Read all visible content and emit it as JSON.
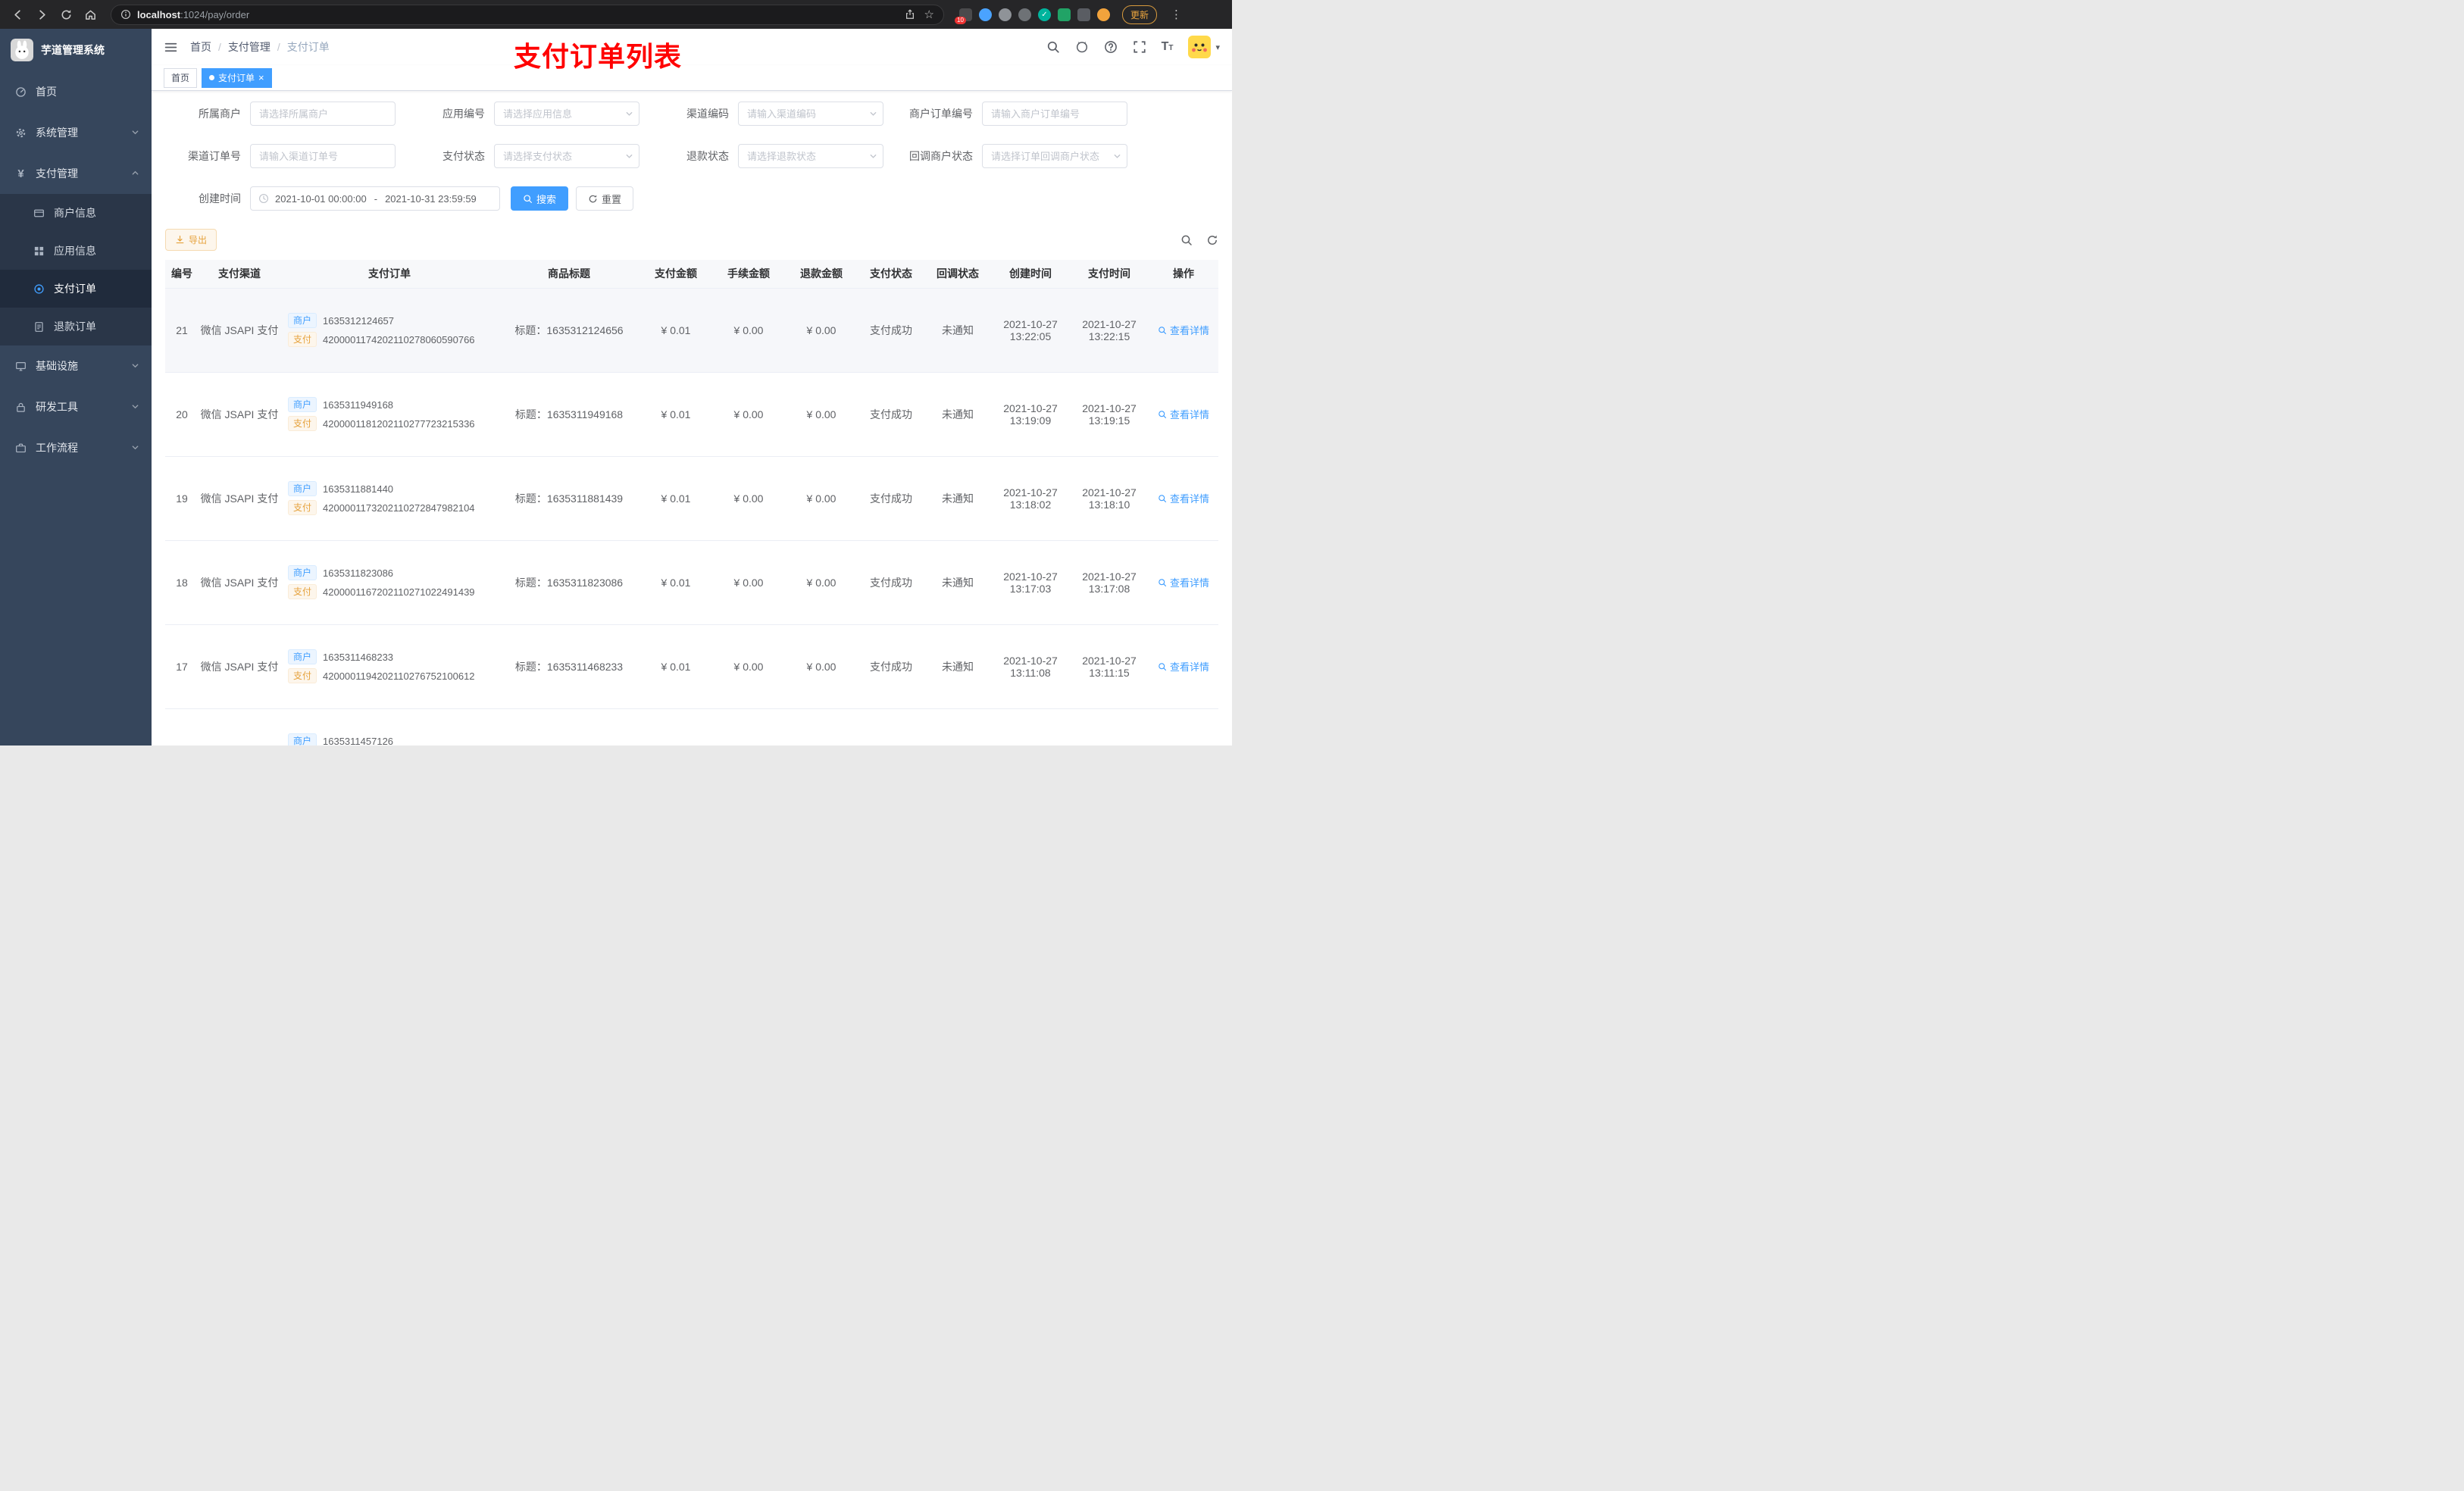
{
  "colors": {
    "accent": "#409eff",
    "warning": "#e6a23c",
    "annotation_red": "#ff0000",
    "sidebar_bg": "#36465c",
    "tab_active_bg": "#409eff",
    "table_header_bg": "#f7f8fa"
  },
  "browser": {
    "url_host": "localhost",
    "url_path": ":1024/pay/order",
    "update_button": "更新",
    "extension_badge": "10"
  },
  "icons": {
    "star": "☆",
    "check": "✓",
    "kebab": "⋮",
    "caret_down": "▾",
    "close": "×",
    "font_large": "T",
    "font_small": "T",
    "yen": "¥"
  },
  "sidebar": {
    "title": "芋道管理系统",
    "items": [
      {
        "label": "首页"
      },
      {
        "label": "系统管理"
      },
      {
        "label": "支付管理"
      },
      {
        "label": "商户信息"
      },
      {
        "label": "应用信息"
      },
      {
        "label": "支付订单"
      },
      {
        "label": "退款订单"
      },
      {
        "label": "基础设施"
      },
      {
        "label": "研发工具"
      },
      {
        "label": "工作流程"
      }
    ]
  },
  "header": {
    "breadcrumb": [
      "首页",
      "支付管理",
      "支付订单"
    ],
    "breadcrumb_separator": "/",
    "annotation": "支付订单列表"
  },
  "tabs": [
    {
      "label": "首页",
      "active": false
    },
    {
      "label": "支付订单",
      "active": true
    }
  ],
  "filters": {
    "fields": [
      {
        "label": "所属商户",
        "placeholder": "请选择所属商户",
        "type": "input"
      },
      {
        "label": "应用编号",
        "placeholder": "请选择应用信息",
        "type": "select"
      },
      {
        "label": "渠道编码",
        "placeholder": "请输入渠道编码",
        "type": "select"
      },
      {
        "label": "商户订单编号",
        "placeholder": "请输入商户订单编号",
        "type": "input"
      },
      {
        "label": "渠道订单号",
        "placeholder": "请输入渠道订单号",
        "type": "input"
      },
      {
        "label": "支付状态",
        "placeholder": "请选择支付状态",
        "type": "select"
      },
      {
        "label": "退款状态",
        "placeholder": "请选择退款状态",
        "type": "select"
      },
      {
        "label": "回调商户状态",
        "placeholder": "请选择订单回调商户状态",
        "type": "select"
      }
    ],
    "date": {
      "label": "创建时间",
      "start": "2021-10-01 00:00:00",
      "separator": "-",
      "end": "2021-10-31 23:59:59"
    },
    "search_button": "搜索",
    "reset_button": "重置"
  },
  "toolbar": {
    "export_button": "导出"
  },
  "table": {
    "columns": [
      "编号",
      "支付渠道",
      "支付订单",
      "商品标题",
      "支付金额",
      "手续金额",
      "退款金额",
      "支付状态",
      "回调状态",
      "创建时间",
      "支付时间",
      "操作"
    ],
    "merchant_badge": "商户",
    "pay_badge": "支付",
    "title_prefix": "标题：",
    "rows": [
      {
        "id": "21",
        "channel": "微信 JSAPI 支付",
        "merchant_no": "1635312124657",
        "pay_no": "4200001174202110278060590766",
        "title": "1635312124656",
        "amount": "¥ 0.01",
        "fee": "¥ 0.00",
        "refund": "¥ 0.00",
        "status": "支付成功",
        "notify": "未通知",
        "created": "2021-10-27 13:22:05",
        "paid": "2021-10-27 13:22:15",
        "action": "查看详情"
      },
      {
        "id": "20",
        "channel": "微信 JSAPI 支付",
        "merchant_no": "1635311949168",
        "pay_no": "4200001181202110277723215336",
        "title": "1635311949168",
        "amount": "¥ 0.01",
        "fee": "¥ 0.00",
        "refund": "¥ 0.00",
        "status": "支付成功",
        "notify": "未通知",
        "created": "2021-10-27 13:19:09",
        "paid": "2021-10-27 13:19:15",
        "action": "查看详情"
      },
      {
        "id": "19",
        "channel": "微信 JSAPI 支付",
        "merchant_no": "1635311881440",
        "pay_no": "4200001173202110272847982104",
        "title": "1635311881439",
        "amount": "¥ 0.01",
        "fee": "¥ 0.00",
        "refund": "¥ 0.00",
        "status": "支付成功",
        "notify": "未通知",
        "created": "2021-10-27 13:18:02",
        "paid": "2021-10-27 13:18:10",
        "action": "查看详情"
      },
      {
        "id": "18",
        "channel": "微信 JSAPI 支付",
        "merchant_no": "1635311823086",
        "pay_no": "4200001167202110271022491439",
        "title": "1635311823086",
        "amount": "¥ 0.01",
        "fee": "¥ 0.00",
        "refund": "¥ 0.00",
        "status": "支付成功",
        "notify": "未通知",
        "created": "2021-10-27 13:17:03",
        "paid": "2021-10-27 13:17:08",
        "action": "查看详情"
      },
      {
        "id": "17",
        "channel": "微信 JSAPI 支付",
        "merchant_no": "1635311468233",
        "pay_no": "4200001194202110276752100612",
        "title": "1635311468233",
        "amount": "¥ 0.01",
        "fee": "¥ 0.00",
        "refund": "¥ 0.00",
        "status": "支付成功",
        "notify": "未通知",
        "created": "2021-10-27 13:11:08",
        "paid": "2021-10-27 13:11:15",
        "action": "查看详情"
      },
      {
        "id": "",
        "channel": "",
        "merchant_no": "1635311457126",
        "pay_no": "",
        "title": "",
        "amount": "",
        "fee": "",
        "refund": "",
        "status": "",
        "notify": "",
        "created": "",
        "paid": "",
        "action": ""
      }
    ]
  }
}
